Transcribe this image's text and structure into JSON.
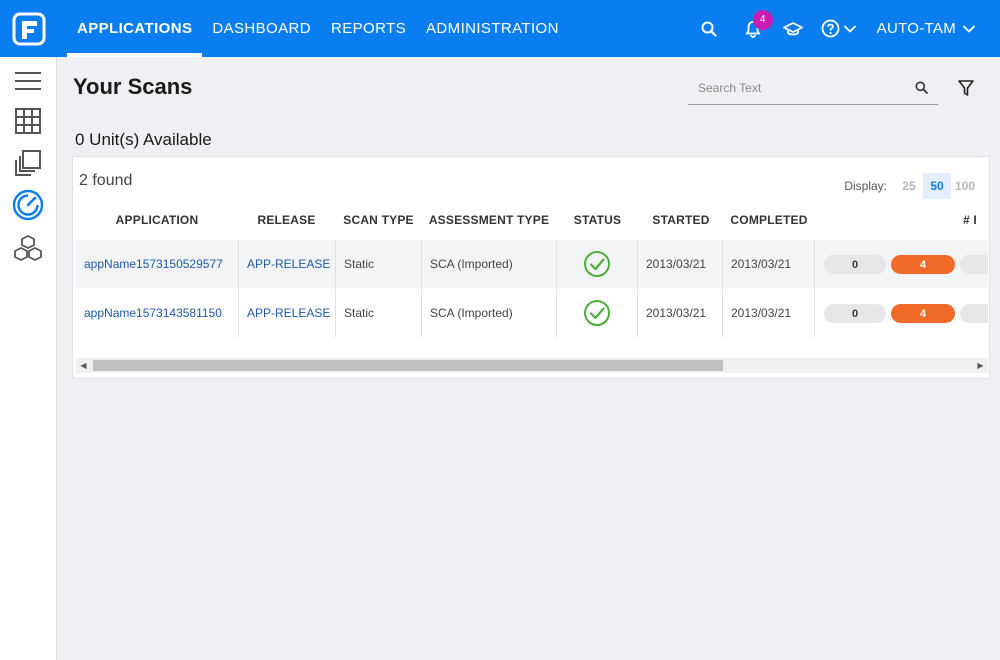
{
  "nav": {
    "items": [
      {
        "label": "APPLICATIONS",
        "active": true
      },
      {
        "label": "DASHBOARD",
        "active": false
      },
      {
        "label": "REPORTS",
        "active": false
      },
      {
        "label": "ADMINISTRATION",
        "active": false
      }
    ],
    "notification_count": "4",
    "user_label": "AUTO-TAM"
  },
  "page": {
    "title": "Your Scans",
    "units_available": "0 Unit(s) Available",
    "search_placeholder": "Search Text",
    "found": "2 found",
    "display_label": "Display:",
    "page_sizes": [
      "25",
      "50",
      "100"
    ],
    "selected_page_size": "50"
  },
  "table": {
    "columns": [
      "APPLICATION",
      "RELEASE",
      "SCAN TYPE",
      "ASSESSMENT TYPE",
      "STATUS",
      "STARTED",
      "COMPLETED",
      "# I"
    ],
    "rows": [
      {
        "application": "appName1573150529577",
        "release": "APP-RELEASE",
        "scan_type": "Static",
        "assessment_type": "SCA (Imported)",
        "status": "complete",
        "started": "2013/03/21",
        "completed": "2013/03/21",
        "issues_a": "0",
        "issues_b": "4"
      },
      {
        "application": "appName1573143581150",
        "release": "APP-RELEASE",
        "scan_type": "Static",
        "assessment_type": "SCA (Imported)",
        "status": "complete",
        "started": "2013/03/21",
        "completed": "2013/03/21",
        "issues_a": "0",
        "issues_b": "4"
      }
    ]
  },
  "icons": {
    "logo": "fortify-logo-icon",
    "search": "search-icon",
    "notifications": "bell-icon",
    "learn": "graduation-cap-icon",
    "help": "question-circle-icon",
    "filter": "filter-icon",
    "sidebar": [
      "menu-icon",
      "grid-icon",
      "copy-icon",
      "scans-gauge-icon",
      "cubes-icon"
    ],
    "status": "check-circle-icon"
  },
  "colors": {
    "primary": "#0a7ef0",
    "badge": "#c81eb4",
    "success": "#4cae3c",
    "issue_orange": "#f26a2a",
    "link": "#1d5aa8"
  }
}
